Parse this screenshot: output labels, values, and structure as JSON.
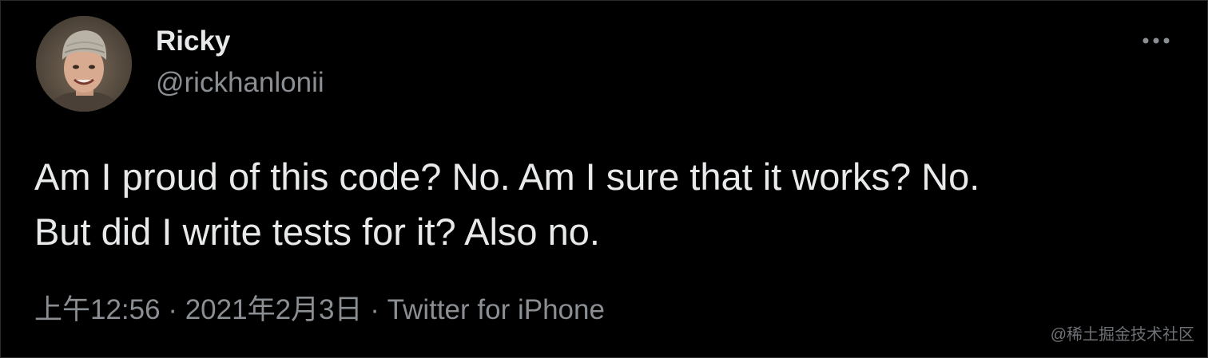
{
  "tweet": {
    "author": {
      "name": "Ricky",
      "handle": "@rickhanlonii"
    },
    "text": "Am I proud of this code? No.  Am I sure that it works? No.\nBut did I write tests for it? Also no.",
    "meta": {
      "time": "上午12:56",
      "separator": " · ",
      "date": "2021年2月3日",
      "source": "Twitter for iPhone"
    },
    "more_icon": "more-horizontal-icon"
  },
  "watermark": "@稀土掘金技术社区",
  "colors": {
    "background": "#000000",
    "primary_text": "#e7e9ea",
    "secondary_text": "#8b8f93"
  }
}
